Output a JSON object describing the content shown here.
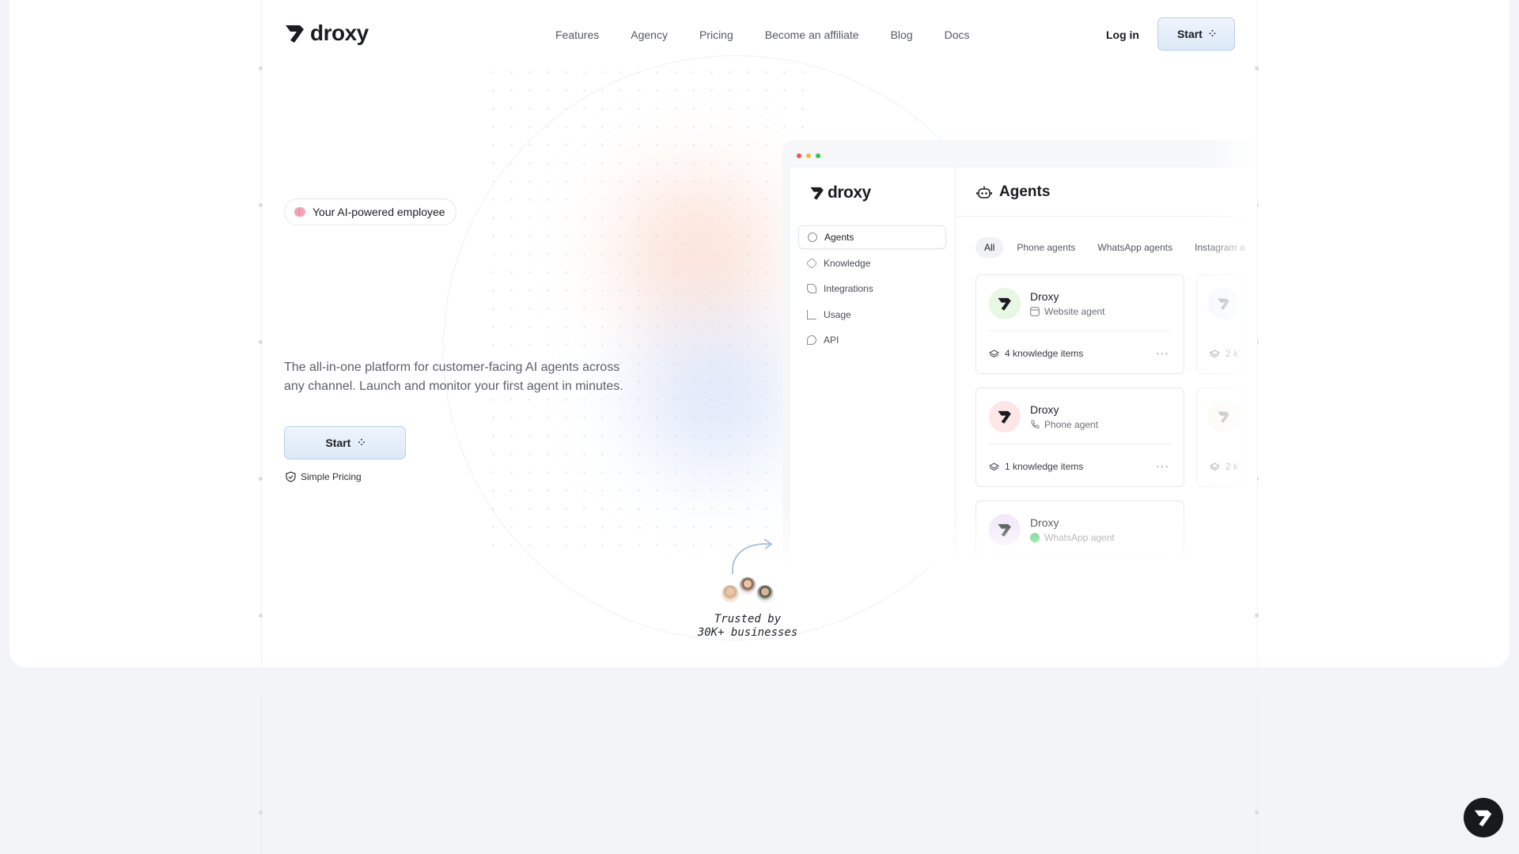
{
  "brand": {
    "name": "droxy"
  },
  "nav": {
    "links": [
      "Features",
      "Agency",
      "Pricing",
      "Become an affiliate",
      "Blog",
      "Docs"
    ],
    "login": "Log in",
    "start": "Start"
  },
  "hero": {
    "badge": "Your AI-powered employee",
    "tagline": "The all-in-one platform for customer-facing AI agents across any channel. Launch and monitor your first agent in minutes.",
    "cta": "Start",
    "pricing_note": "Simple Pricing"
  },
  "app": {
    "brand": "droxy",
    "sidebar": [
      "Agents",
      "Knowledge",
      "Integrations",
      "Usage",
      "API"
    ],
    "title": "Agents",
    "filters": [
      "All",
      "Phone agents",
      "WhatsApp agents",
      "Instagram a"
    ],
    "agents": [
      {
        "name": "Droxy",
        "type": "Website agent",
        "knowledge": "4 knowledge items",
        "avatar_color": "#e8f6e4"
      },
      {
        "name": "Droxy",
        "type": "Phone agent",
        "knowledge": "1 knowledge items",
        "avatar_color": "#fde6e8"
      },
      {
        "name": "Droxy",
        "type": "WhatsApp agent",
        "avatar_color": "#f1e4f8"
      }
    ],
    "ghost_knowledge": [
      "2 k",
      "2 k"
    ]
  },
  "trusted": {
    "line1": "Trusted by",
    "line2": "30K+ businesses"
  },
  "colors": {
    "accent_bg": "#e6eefa",
    "accent_border": "#b9cdea",
    "whatsapp": "#28c44c"
  }
}
